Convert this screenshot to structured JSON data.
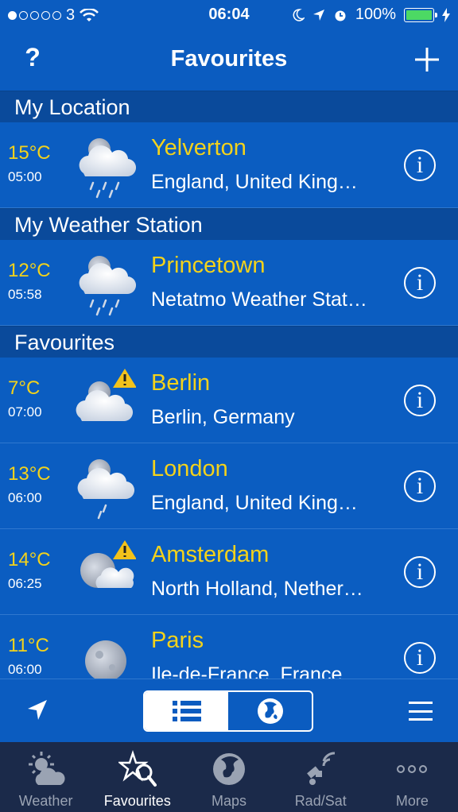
{
  "status": {
    "carrier": "3",
    "time": "06:04",
    "battery": "100%"
  },
  "nav": {
    "help_label": "?",
    "title": "Favourites"
  },
  "sections": {
    "my_location": "My Location",
    "my_station": "My Weather Station",
    "favourites": "Favourites"
  },
  "rows": [
    {
      "temp": "15°C",
      "time": "05:00",
      "city": "Yelverton",
      "region": "England, United King…",
      "icon": "partly-cloudy-night-rain-icon"
    },
    {
      "temp": "12°C",
      "time": "05:58",
      "city": "Princetown",
      "region": "Netatmo Weather Stat…",
      "icon": "partly-cloudy-night-rain-icon"
    },
    {
      "temp": "7°C",
      "time": "07:00",
      "city": "Berlin",
      "region": "Berlin, Germany",
      "icon": "cloudy-night-warning-icon"
    },
    {
      "temp": "13°C",
      "time": "06:00",
      "city": "London",
      "region": "England, United King…",
      "icon": "cloudy-night-drizzle-icon"
    },
    {
      "temp": "14°C",
      "time": "06:25",
      "city": "Amsterdam",
      "region": "North Holland, Nether…",
      "icon": "moon-cloud-warning-icon"
    },
    {
      "temp": "11°C",
      "time": "06:00",
      "city": "Paris",
      "region": "Ile-de-France, France",
      "icon": "moon-icon"
    }
  ],
  "tabs": [
    {
      "label": "Weather",
      "icon": "weather-icon"
    },
    {
      "label": "Favourites",
      "icon": "favourites-icon"
    },
    {
      "label": "Maps",
      "icon": "globe-icon"
    },
    {
      "label": "Rad/Sat",
      "icon": "satellite-icon"
    },
    {
      "label": "More",
      "icon": "more-icon"
    }
  ],
  "colors": {
    "accent_yellow": "#f3d21b",
    "background": "#0a5bbd",
    "section": "#0a4a9b",
    "tabbar": "#1b2a4a"
  }
}
